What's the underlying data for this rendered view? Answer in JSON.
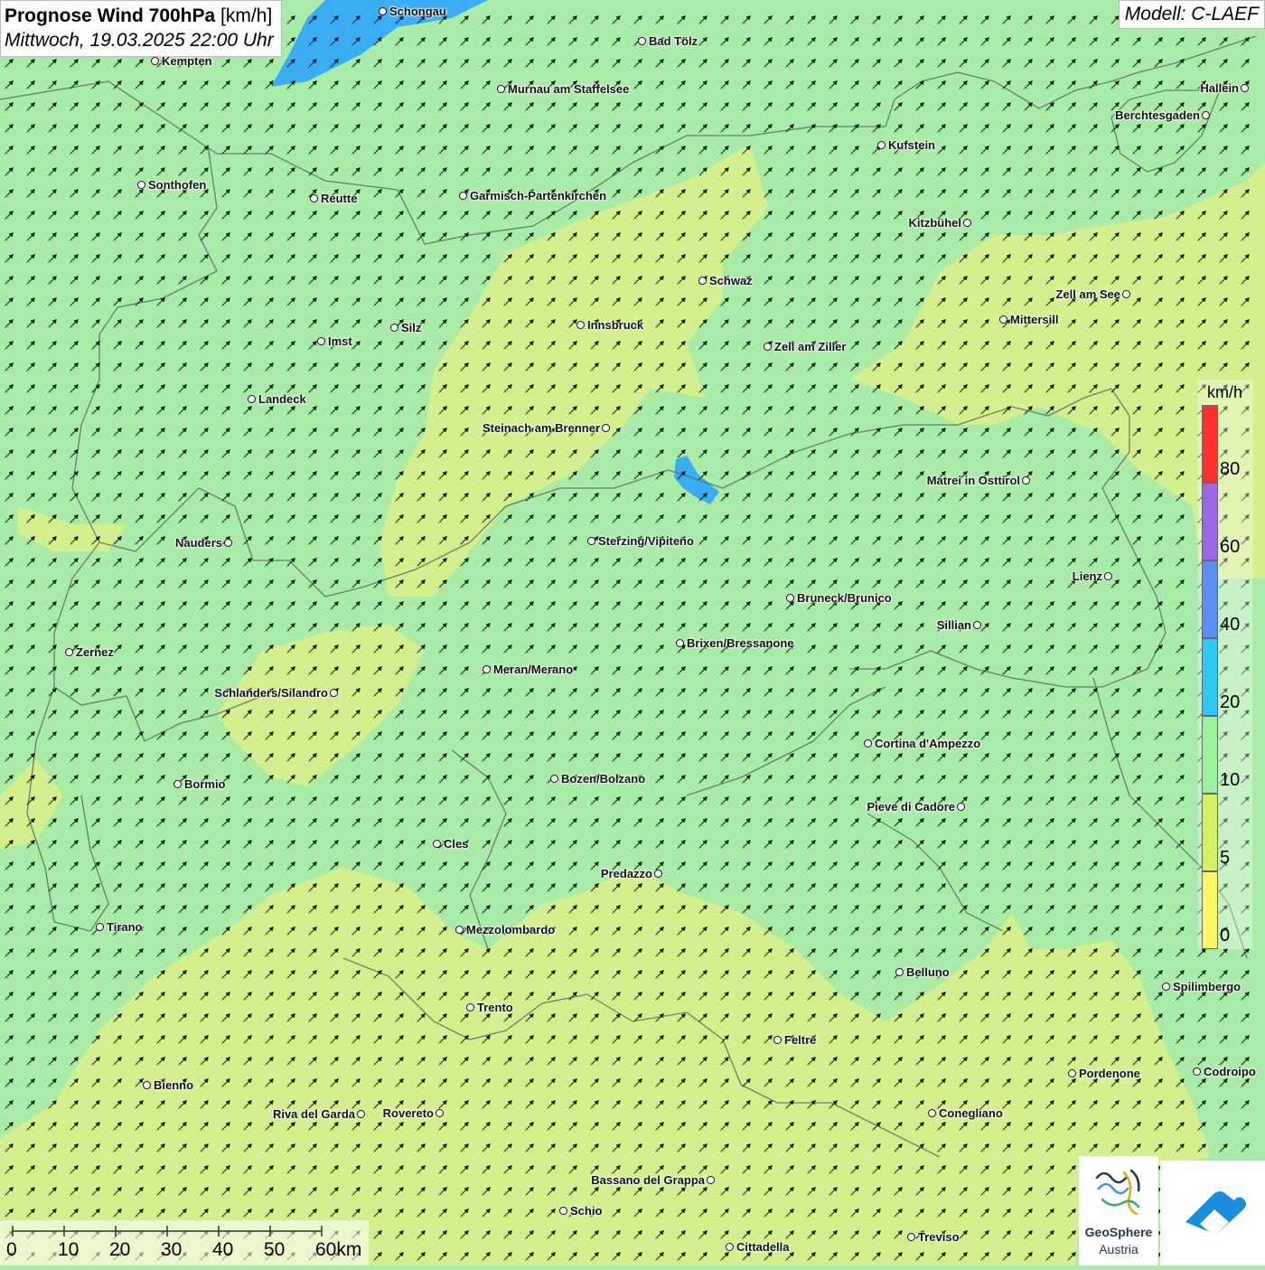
{
  "title": {
    "main": "Prognose Wind 700hPa",
    "unit": "[km/h]",
    "datetime": "Mittwoch, 19.03.2025 22:00 Uhr"
  },
  "model": "Modell: C-LAEF",
  "colors": {
    "light_green": "#a8eca8",
    "yellow_green": "#d6f08c",
    "lake_blue": "#3aaef5"
  },
  "cities": [
    {
      "name": "Schongau"
    },
    {
      "name": "Bad Tölz"
    },
    {
      "name": "Kempten"
    },
    {
      "name": "Murnau am Staffelsee"
    },
    {
      "name": "Hallein"
    },
    {
      "name": "Berchtesgaden"
    },
    {
      "name": "Kufstein"
    },
    {
      "name": "Sonthofen"
    },
    {
      "name": "Reutte"
    },
    {
      "name": "Garmisch-Partenkirchen"
    },
    {
      "name": "Kitzbühel"
    },
    {
      "name": "Schwaz"
    },
    {
      "name": "Zell am See"
    },
    {
      "name": "Innsbruck"
    },
    {
      "name": "Mittersill"
    },
    {
      "name": "Silz"
    },
    {
      "name": "Imst"
    },
    {
      "name": "Zell am Ziller"
    },
    {
      "name": "Landeck"
    },
    {
      "name": "Steinach am Brenner"
    },
    {
      "name": "Matrei in Osttirol"
    },
    {
      "name": "Nauders"
    },
    {
      "name": "Sterzing/Vipiteno"
    },
    {
      "name": "Lienz"
    },
    {
      "name": "Bruneck/Brunico"
    },
    {
      "name": "Sillian"
    },
    {
      "name": "Zernez"
    },
    {
      "name": "Brixen/Bressanone"
    },
    {
      "name": "Meran/Merano"
    },
    {
      "name": "Schlanders/Silandro"
    },
    {
      "name": "Cortina d'Ampezzo"
    },
    {
      "name": "Bozen/Bolzano"
    },
    {
      "name": "Bormio"
    },
    {
      "name": "Pieve di Cadore"
    },
    {
      "name": "Cles"
    },
    {
      "name": "Predazzo"
    },
    {
      "name": "Tirano"
    },
    {
      "name": "Mezzolombardo"
    },
    {
      "name": "Belluno"
    },
    {
      "name": "Spilimbergo"
    },
    {
      "name": "Trento"
    },
    {
      "name": "Feltre"
    },
    {
      "name": "Pordenone"
    },
    {
      "name": "Codroipo"
    },
    {
      "name": "Bienno"
    },
    {
      "name": "Riva del Garda"
    },
    {
      "name": "Rovereto"
    },
    {
      "name": "Conegliano"
    },
    {
      "name": "Bassano del Grappa"
    },
    {
      "name": "Schio"
    },
    {
      "name": "Treviso"
    },
    {
      "name": "Cittadella"
    }
  ],
  "legend": {
    "unit": "km/h",
    "labels": [
      "80",
      "60",
      "40",
      "20",
      "10",
      "5",
      "0"
    ],
    "colors": [
      "#ff3030",
      "#9b66e8",
      "#5b8ef0",
      "#2ec8f5",
      "#9cf0a0",
      "#d2f060",
      "#fff566"
    ]
  },
  "scalebar": {
    "labels": [
      "0",
      "10",
      "20",
      "30",
      "40",
      "50",
      "60km"
    ]
  },
  "logos": {
    "geosphere_line1": "GeoSphere",
    "geosphere_line2": "Austria"
  }
}
